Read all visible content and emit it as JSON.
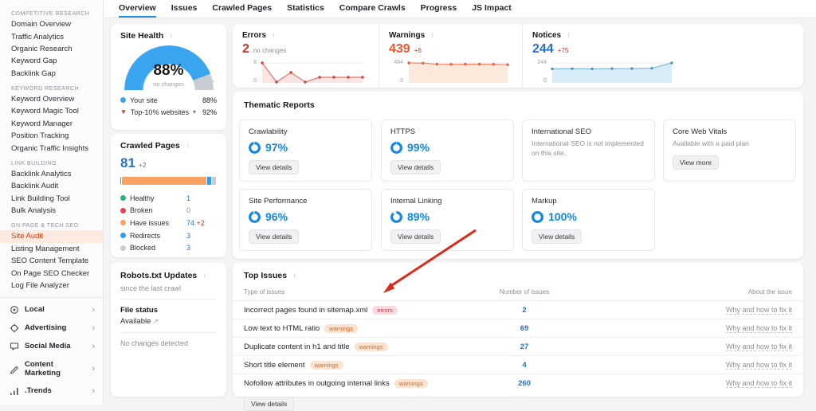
{
  "icons": {
    "info": "i",
    "external": "↗",
    "chevron_down": "▾",
    "chevron_right": "›",
    "triangle_down": "▼"
  },
  "colors": {
    "accent_blue": "#0f87e6",
    "donut_track": "#d6eafc",
    "link_blue": "#2671c4"
  },
  "sidebar": {
    "sections": [
      {
        "title": "COMPETITIVE RESEARCH",
        "items": [
          "Domain Overview",
          "Traffic Analytics",
          "Organic Research",
          "Keyword Gap",
          "Backlink Gap"
        ]
      },
      {
        "title": "KEYWORD RESEARCH",
        "items": [
          "Keyword Overview",
          "Keyword Magic Tool",
          "Keyword Manager",
          "Position Tracking",
          "Organic Traffic Insights"
        ]
      },
      {
        "title": "LINK BUILDING",
        "items": [
          "Backlink Analytics",
          "Backlink Audit",
          "Link Building Tool",
          "Bulk Analysis"
        ]
      },
      {
        "title": "ON PAGE & TECH SEO",
        "items": [
          "Site Audit",
          "Listing Management",
          "SEO Content Template",
          "On Page SEO Checker",
          "Log File Analyzer"
        ],
        "active": "Site Audit"
      }
    ],
    "bottom_items": [
      {
        "icon": "local-icon",
        "label": "Local"
      },
      {
        "icon": "advertising-icon",
        "label": "Advertising"
      },
      {
        "icon": "social-media-icon",
        "label": "Social Media"
      },
      {
        "icon": "content-marketing-icon",
        "label": "Content Marketing"
      },
      {
        "icon": "trends-icon",
        "label": ".Trends"
      }
    ]
  },
  "tabs": {
    "items": [
      "Overview",
      "Issues",
      "Crawled Pages",
      "Statistics",
      "Compare Crawls",
      "Progress",
      "JS Impact"
    ],
    "active": "Overview"
  },
  "site_health": {
    "title": "Site Health",
    "value": 88,
    "value_label": "88%",
    "change_label": "no changes",
    "arc_color": "#3aa5f1",
    "track_color": "#c9cdd3",
    "benchmark": 92,
    "rows": [
      {
        "label": "Your site",
        "value": "88%",
        "dot_color": "#3aa5f1"
      },
      {
        "label": "Top-10% websites",
        "value": "92%"
      }
    ]
  },
  "stats": [
    {
      "title": "Errors",
      "value": "2",
      "value_color": "#d6301f",
      "change": "no changes",
      "change_color": "#8c8f94",
      "axis_max_label": "8",
      "axis_min_label": "0",
      "chart": {
        "type": "line",
        "values": [
          8,
          0,
          4,
          0,
          2,
          2,
          2,
          2
        ],
        "max": 8,
        "line": "#e4756b",
        "fill": "#fae4e4",
        "marker": "#cf4138"
      }
    },
    {
      "title": "Warnings",
      "value": "439",
      "value_color": "#ef5430",
      "change": "+6",
      "change_color": "#d6301f",
      "axis_max_label": "484",
      "axis_min_label": "0",
      "chart": {
        "type": "area",
        "values": [
          484,
          479,
          452,
          448,
          451,
          453,
          449,
          439
        ],
        "max": 484,
        "line": "#ee8566",
        "fill": "#fbe9dc",
        "marker": "#e4623d"
      }
    },
    {
      "title": "Notices",
      "value": "244",
      "value_color": "#2871c8",
      "change": "+75",
      "change_color": "#d6301f",
      "axis_max_label": "244",
      "axis_min_label": "0",
      "chart": {
        "type": "area",
        "values": [
          168,
          170,
          168,
          171,
          172,
          176,
          244
        ],
        "max": 244,
        "line": "#7fb9d9",
        "fill": "#d9edf8",
        "marker": "#4a98c6"
      }
    }
  ],
  "thematic": {
    "title": "Thematic Reports",
    "cards": [
      {
        "name": "Crawlability",
        "percent": 97,
        "percent_label": "97%",
        "button": "View details"
      },
      {
        "name": "HTTPS",
        "percent": 99,
        "percent_label": "99%",
        "button": "View details"
      },
      {
        "name": "International SEO",
        "description": "International SEO is not implemented on this site."
      },
      {
        "name": "Core Web Vitals",
        "description": "Available with a paid plan",
        "button": "View more"
      },
      {
        "name": "Site Performance",
        "percent": 96,
        "percent_label": "96%",
        "button": "View details"
      },
      {
        "name": "Internal Linking",
        "percent": 89,
        "percent_label": "89%",
        "button": "View details"
      },
      {
        "name": "Markup",
        "percent": 100,
        "percent_label": "100%",
        "button": "View details"
      }
    ]
  },
  "crawled_pages": {
    "title": "Crawled Pages",
    "value": "81",
    "change": "+2",
    "legend": [
      {
        "label": "Healthy",
        "value": "1",
        "color": "#23b574",
        "share": 2
      },
      {
        "label": "Broken",
        "value": "0",
        "value_color": "#8c8f94",
        "color": "#e8434f",
        "share": 0
      },
      {
        "label": "Have issues",
        "value": "74",
        "extra": "+2",
        "color": "#f5a263",
        "share": 88
      },
      {
        "label": "Redirects",
        "value": "3",
        "color": "#2d9cf4",
        "share": 5
      },
      {
        "label": "Blocked",
        "value": "3",
        "color": "#c9cbce",
        "share": 5
      }
    ]
  },
  "robots": {
    "title": "Robots.txt Updates",
    "subtitle": "since the last crawl",
    "file_status_label": "File status",
    "file_status_value": "Available",
    "note": "No changes detected"
  },
  "top_issues": {
    "title": "Top Issues",
    "columns": [
      "Type of issues",
      "Number of issues",
      "About the issue"
    ],
    "rows": [
      {
        "issue": "Incorrect pages found in sitemap.xml",
        "badge": "errors",
        "count": "2",
        "link": "Why and how to fix it"
      },
      {
        "issue": "Low text to HTML ratio",
        "badge": "warnings",
        "count": "69",
        "link": "Why and how to fix it"
      },
      {
        "issue": "Duplicate content in h1 and title",
        "badge": "warnings",
        "count": "27",
        "link": "Why and how to fix it"
      },
      {
        "issue": "Short title element",
        "badge": "warnings",
        "count": "4",
        "link": "Why and how to fix it"
      },
      {
        "issue": "Nofollow attributes in outgoing internal links",
        "badge": "warnings",
        "count": "260",
        "link": "Why and how to fix it"
      }
    ],
    "button": "View details"
  }
}
